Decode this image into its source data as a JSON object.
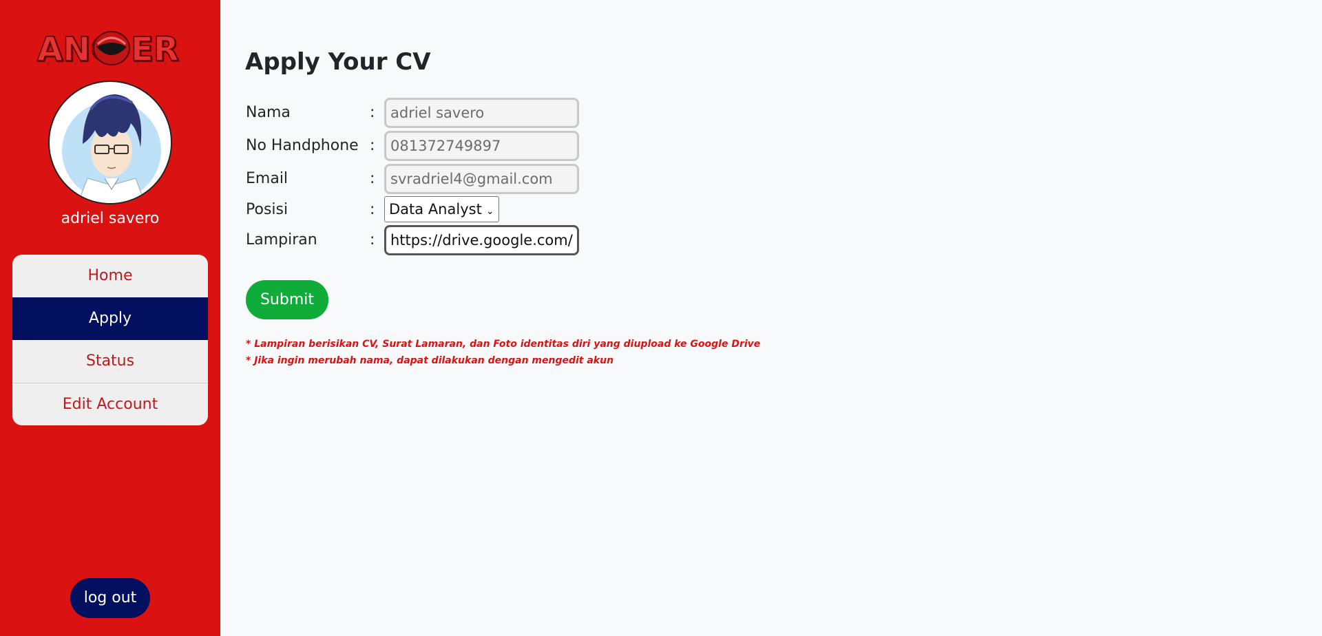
{
  "sidebar": {
    "logo_text": "ANGKER",
    "username": "adriel savero",
    "menu": [
      {
        "label": "Home",
        "active": false
      },
      {
        "label": "Apply",
        "active": true
      },
      {
        "label": "Status",
        "active": false
      },
      {
        "label": "Edit Account",
        "active": false
      }
    ],
    "logout_label": "log out"
  },
  "form": {
    "title": "Apply Your CV",
    "colon": ":",
    "fields": [
      {
        "label": "Nama",
        "value": "adriel savero"
      },
      {
        "label": "No Handphone",
        "value": "081372749897"
      },
      {
        "label": "Email",
        "value": "svradriel4@gmail.com"
      },
      {
        "label": "Posisi",
        "value": "Data Analyst"
      },
      {
        "label": "Lampiran",
        "value": "https://drive.google.com/"
      }
    ],
    "submit_label": "Submit",
    "notes": [
      "* Lampiran berisikan CV, Surat Lamaran, dan Foto identitas diri yang diupload ke Google Drive",
      "* Jika ingin merubah nama, dapat dilakukan dengan mengedit akun"
    ]
  },
  "colors": {
    "sidebar": "#da1212",
    "navy": "#031060",
    "submit": "#0fac3a",
    "note": "#e01010"
  },
  "icons": {
    "select_arrow": "chevron-down-icon"
  }
}
